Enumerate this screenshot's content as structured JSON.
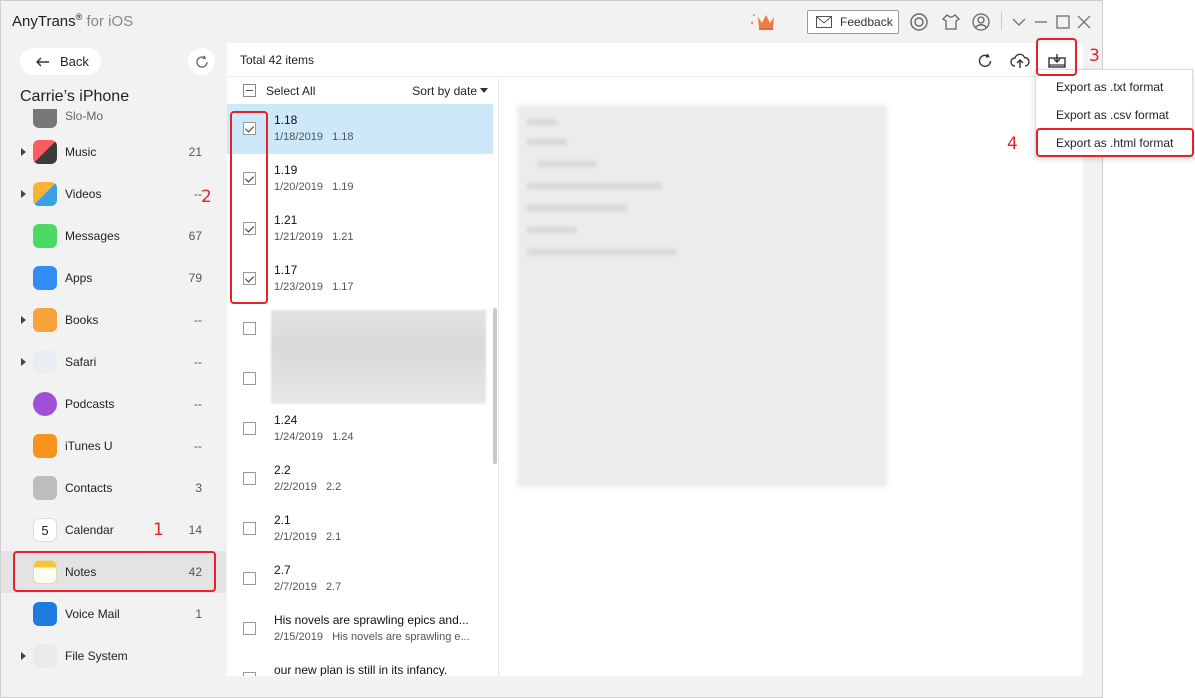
{
  "app": {
    "title": "AnyTrans",
    "reg": "®",
    "subtitle": "for iOS"
  },
  "toolbar": {
    "feedback_label": "Feedback"
  },
  "sidebar": {
    "back_label": "Back",
    "device_name": "Carrie’s iPhone",
    "items": [
      {
        "label": "Music",
        "count": "21"
      },
      {
        "label": "Videos",
        "count": "--"
      },
      {
        "label": "Messages",
        "count": "67"
      },
      {
        "label": "Apps",
        "count": "79"
      },
      {
        "label": "Books",
        "count": "--"
      },
      {
        "label": "Safari",
        "count": "--"
      },
      {
        "label": "Podcasts",
        "count": "--"
      },
      {
        "label": "iTunes U",
        "count": "--"
      },
      {
        "label": "Contacts",
        "count": "3"
      },
      {
        "label": "Calendar",
        "count": "14"
      },
      {
        "label": "Notes",
        "count": "42"
      },
      {
        "label": "Voice Mail",
        "count": "1"
      },
      {
        "label": "File System",
        "count": ""
      }
    ],
    "partial_item": "Slo-Mo"
  },
  "main": {
    "total_label": "Total 42 items",
    "select_all_label": "Select All",
    "sort_label": "Sort by date",
    "notes": [
      {
        "title": "1.18",
        "date": "1/18/2019",
        "preview": "1.18"
      },
      {
        "title": "1.19",
        "date": "1/20/2019",
        "preview": "1.19"
      },
      {
        "title": "1.21",
        "date": "1/21/2019",
        "preview": "1.21"
      },
      {
        "title": "1.17",
        "date": "1/23/2019",
        "preview": "1.17"
      },
      {
        "title": "1.24",
        "date": "1/24/2019",
        "preview": "1.24"
      },
      {
        "title": "2.2",
        "date": "2/2/2019",
        "preview": "2.2"
      },
      {
        "title": "2.1",
        "date": "2/1/2019",
        "preview": "2.1"
      },
      {
        "title": "2.7",
        "date": "2/7/2019",
        "preview": "2.7"
      },
      {
        "title": "His novels are sprawling epics and...",
        "date": "2/15/2019",
        "preview": "His novels are sprawling e..."
      },
      {
        "title": "our new plan is still in its infancy.",
        "date": "",
        "preview": ""
      }
    ]
  },
  "export_menu": {
    "items": [
      {
        "label": "Export as .txt format"
      },
      {
        "label": "Export as .csv format"
      },
      {
        "label": "Export as .html format"
      }
    ]
  },
  "annotations": [
    "1",
    "2",
    "3",
    "4"
  ],
  "colors": {
    "accent_red": "#e5212b",
    "selected_row": "#cce8f9",
    "notes_icon": "#f5c531"
  }
}
